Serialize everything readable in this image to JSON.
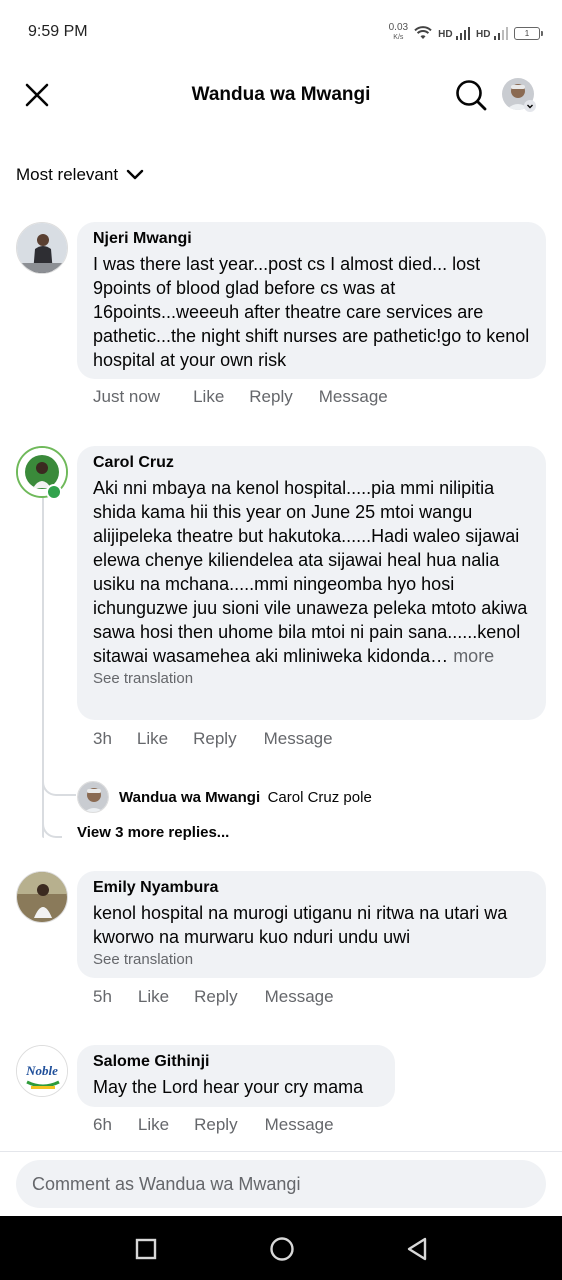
{
  "status_bar": {
    "time": "9:59 PM",
    "net_speed": "0.03",
    "net_unit": "K/s",
    "sim1": "HD",
    "sim2": "HD",
    "battery": "1"
  },
  "header": {
    "title": "Wandua wa Mwangi",
    "icons": [
      "close-icon",
      "search-icon",
      "profile-avatar"
    ]
  },
  "sort": {
    "label": "Most relevant"
  },
  "comments": [
    {
      "author": "Njeri Mwangi",
      "text": "I was there last year...post cs I almost died... lost 9points of blood glad before cs was at 16points...weeeuh after theatre care services are pathetic...the night shift nurses are pathetic!go to kenol hospital at your own risk",
      "time": "Just now",
      "actions": [
        "Like",
        "Reply",
        "Message"
      ]
    },
    {
      "author": "Carol Cruz",
      "text": "Aki nni mbaya na kenol hospital.....pia mmi nilipitia shida kama hii this year on June 25 mtoi wangu alijipeleka theatre but hakutoka......Hadi waleo sijawai elewa chenye kiliendelea ata sijawai heal hua nalia usiku na mchana.....mmi ningeomba hyo hosi ichunguzwe juu sioni vile unaweza peleka mtoto akiwa sawa hosi then uhome bila mtoi ni pain sana......kenol sitawai wasamehea aki mliniweka kidonda…",
      "more": "more",
      "translation": "See translation",
      "time": "3h",
      "actions": [
        "Like",
        "Reply",
        "Message"
      ],
      "reply": {
        "author": "Wandua wa Mwangi",
        "text": "Carol Cruz pole"
      },
      "view_more": "View 3 more replies..."
    },
    {
      "author": "Emily Nyambura",
      "text": "kenol hospital na murogi utiganu ni ritwa na utari wa kworwo na murwaru kuo nduri undu uwi",
      "translation": "See translation",
      "time": "5h",
      "actions": [
        "Like",
        "Reply",
        "Message"
      ]
    },
    {
      "author": "Salome Githinji",
      "avatar_logo": "Noble",
      "text": "May the Lord hear your cry mama",
      "time": "6h",
      "actions": [
        "Like",
        "Reply",
        "Message"
      ]
    }
  ],
  "composer": {
    "placeholder": "Comment as Wandua wa Mwangi"
  },
  "nav": [
    "recents-icon",
    "home-icon",
    "back-icon"
  ],
  "colors": {
    "bubble": "#f0f2f5",
    "secondary_text": "#65676b",
    "navbar": "#000000"
  }
}
